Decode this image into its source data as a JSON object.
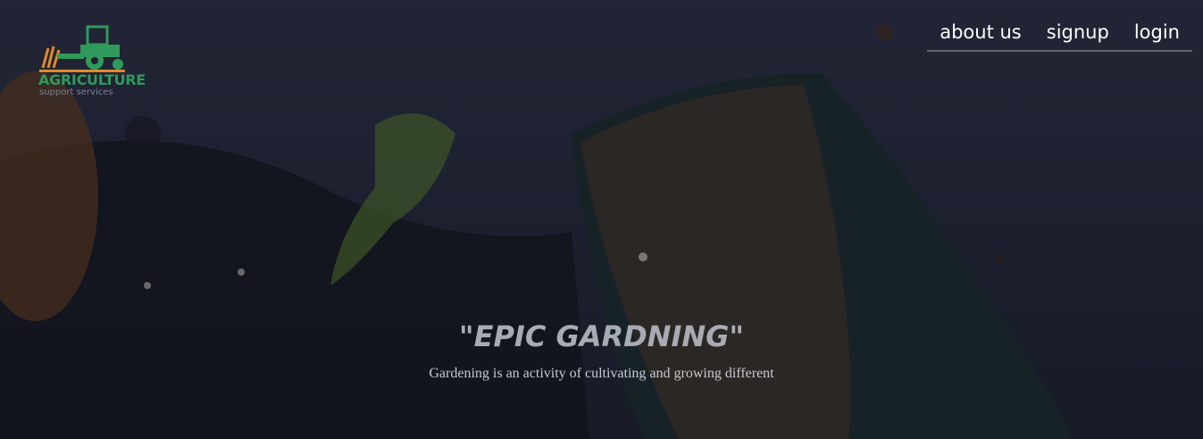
{
  "logo": {
    "title": "AGRICULTURE",
    "subtitle": "support services"
  },
  "nav": {
    "items": [
      {
        "label": "about us"
      },
      {
        "label": "signup"
      },
      {
        "label": "login"
      }
    ]
  },
  "hero": {
    "headline": "\"EPIC GARDNING\"",
    "description": "Gardening is an activity of cultivating and growing different"
  },
  "colors": {
    "logo_green": "#2f9a5b",
    "logo_orange": "#e08a2c",
    "nav_text": "#ffffff"
  }
}
